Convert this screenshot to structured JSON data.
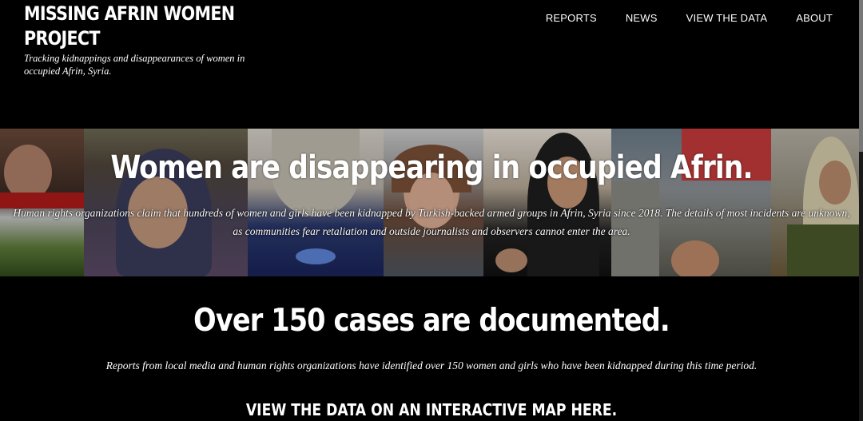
{
  "brand": {
    "title_line1": "MISSING AFRIN WOMEN",
    "title_line2": "PROJECT",
    "tagline": "Tracking kidnappings and disappearances of women in occupied Afrin, Syria."
  },
  "nav": {
    "items": [
      {
        "label": "REPORTS"
      },
      {
        "label": "NEWS"
      },
      {
        "label": "VIEW THE DATA"
      },
      {
        "label": "ABOUT"
      }
    ]
  },
  "hero": {
    "heading": "Women are disappearing in occupied Afrin.",
    "text": "Human rights organizations claim that hundreds of women and girls have been kidnapped by Turkish-backed armed groups in Afrin, Syria since 2018. The details of most incidents are unknown, as communities fear retaliation and outside journalists and observers cannot enter the area."
  },
  "stats": {
    "heading": "Over 150 cases are documented.",
    "text": "Reports from local media and human rights organizations have identified over 150 women and girls who have been kidnapped during this time period."
  },
  "cta": {
    "label": "VIEW THE DATA ON AN INTERACTIVE MAP HERE."
  },
  "colors": {
    "background": "#000000",
    "text": "#ffffff"
  }
}
